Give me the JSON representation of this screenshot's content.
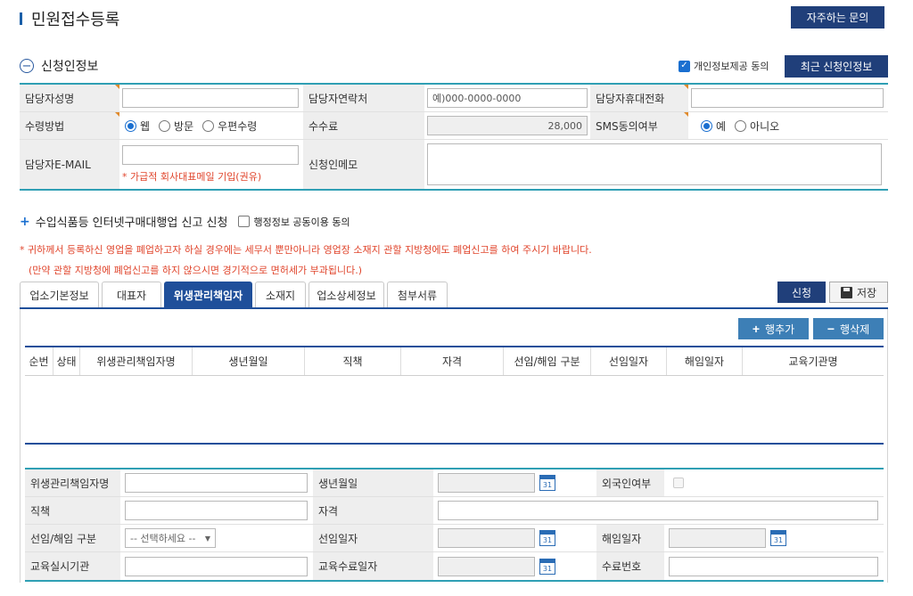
{
  "page": {
    "title": "민원접수등록",
    "faq_label": "자주하는 문의"
  },
  "applicant": {
    "section_title": "신청인정보",
    "consent_label": "개인정보제공 동의",
    "recent_btn": "최근 신청인정보",
    "fields": {
      "name_label": "담당자성명",
      "contact_label": "담당자연락처",
      "contact_placeholder": "예)000-0000-0000",
      "mobile_label": "담당자휴대전화",
      "receive_label": "수령방법",
      "receive_options": [
        "웹",
        "방문",
        "우편수령"
      ],
      "fee_label": "수수료",
      "fee_value": "28,000",
      "sms_label": "SMS동의여부",
      "sms_options": [
        "예",
        "아니오"
      ],
      "email_label": "담당자E-MAIL",
      "email_note": "* 가급적 회사대표메일 기입(권유)",
      "memo_label": "신청인메모"
    }
  },
  "report": {
    "title": "수입식품등 인터넷구매대행업 신고 신청",
    "share_label": "행정정보 공동이용 동의",
    "warning1": "* 귀하께서 등록하신 영업을 폐업하고자 하실 경우에는 세무서 뿐만아니라 영업장 소재지 관할 지방청에도 폐업신고를 하여 주시기 바랍니다.",
    "warning2": "(만약 관할 지방청에 폐업신고를 하지 않으시면 경기적으로 면허세가 부과됩니다.)"
  },
  "tabs": [
    "업소기본정보",
    "대표자",
    "위생관리책임자",
    "소재지",
    "업소상세정보",
    "첨부서류"
  ],
  "actions": {
    "apply": "신청",
    "save": "저장",
    "add_row": "행추가",
    "delete_row": "행삭제"
  },
  "grid": {
    "headers": [
      "순번",
      "상태",
      "위생관리책임자명",
      "생년월일",
      "직책",
      "자격",
      "선임/해임 구분",
      "선임일자",
      "해임일자",
      "교육기관명"
    ]
  },
  "detail": {
    "manager_name_label": "위생관리책임자명",
    "birth_label": "생년월일",
    "foreigner_label": "외국인여부",
    "position_label": "직책",
    "qualification_label": "자격",
    "appoint_type_label": "선임/해임 구분",
    "appoint_type_placeholder": "-- 선택하세요 --",
    "appoint_date_label": "선임일자",
    "dismiss_date_label": "해임일자",
    "edu_org_label": "교육실시기관",
    "edu_done_label": "교육수료일자",
    "cert_no_label": "수료번호",
    "calendar_text": "31"
  }
}
